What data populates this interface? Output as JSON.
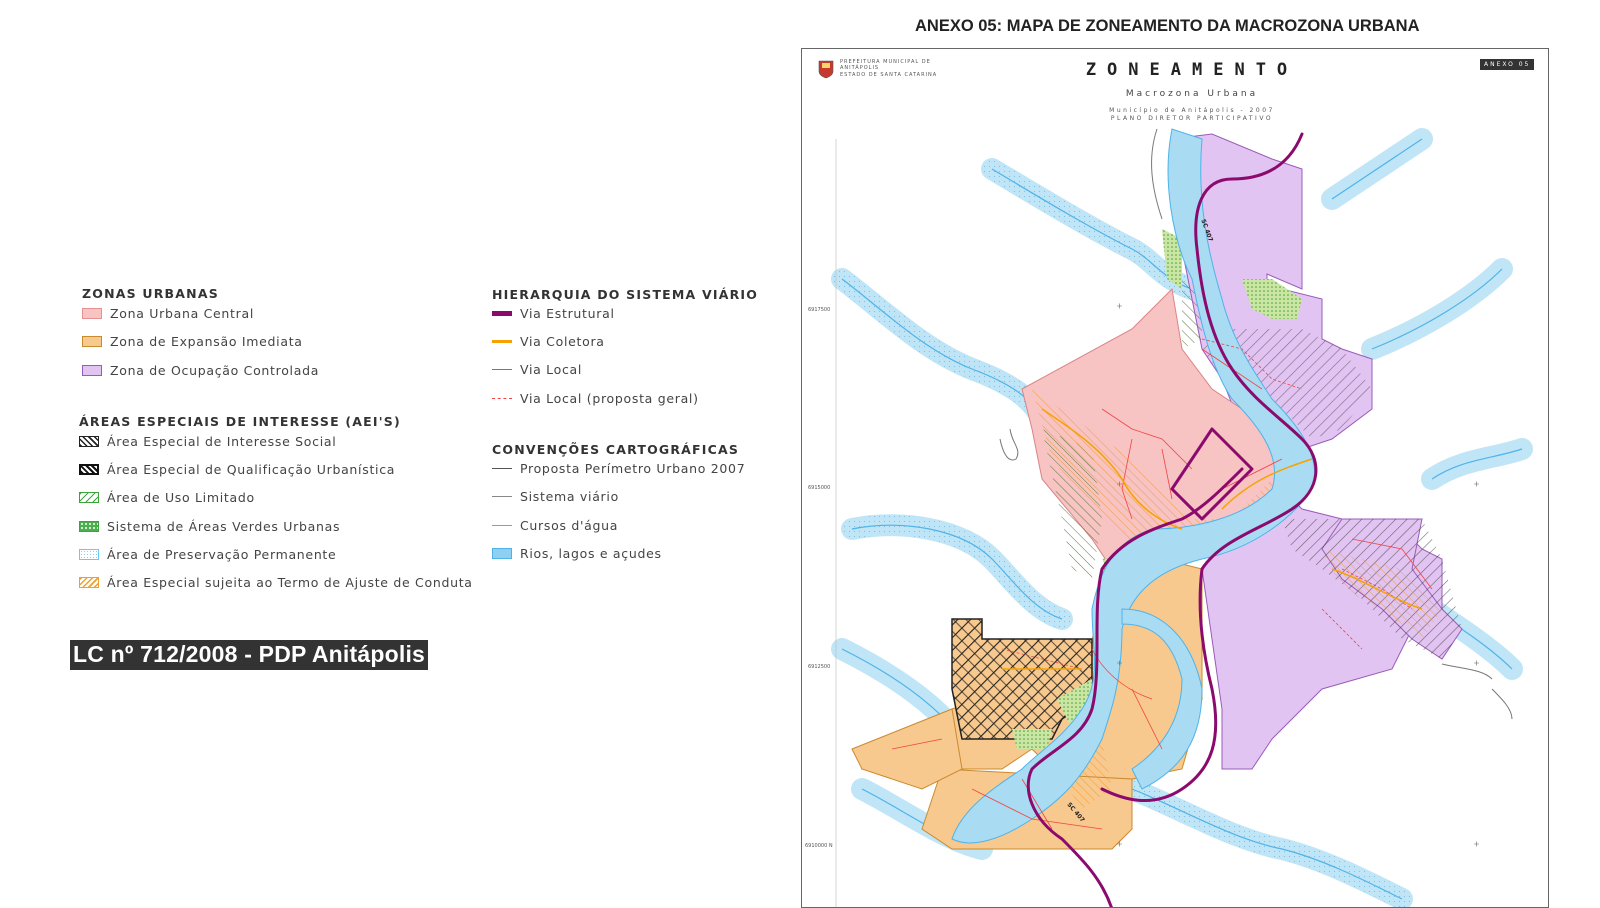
{
  "main_title": "ANEXO 05: MAPA DE ZONEAMENTO DA MACROZONA URBANA",
  "caption": "LC nº 712/2008 - PDP Anitápolis",
  "legend_left": {
    "zonas_title": "ZONAS URBANAS",
    "zonas": [
      {
        "label": "Zona Urbana Central",
        "color": "#f8c3c3"
      },
      {
        "label": "Zona de Expansão Imediata",
        "color": "#f8c98e"
      },
      {
        "label": "Zona de Ocupação Controlada",
        "color": "#e2c4f2"
      }
    ],
    "aei_title": "ÁREAS ESPECIAIS DE INTERESSE (AEI'S)",
    "aei": [
      {
        "label": "Área Especial de Interesse Social",
        "icon": "diagonal-hatch-black"
      },
      {
        "label": "Área Especial de Qualificação Urbanística",
        "icon": "cross-hatch-black"
      },
      {
        "label": "Área de Uso Limitado",
        "icon": "diagonal-hatch-green"
      },
      {
        "label": "Sistema de Áreas Verdes Urbanas",
        "icon": "dotted-green"
      },
      {
        "label": "Área de Preservação Permanente",
        "icon": "dotted-cyan"
      },
      {
        "label": "Área Especial sujeita ao Termo de Ajuste de Conduta",
        "icon": "hatch-orange"
      }
    ]
  },
  "legend_right": {
    "viario_title": "HIERARQUIA DO SISTEMA VIÁRIO",
    "viario": [
      {
        "label": "Via Estrutural",
        "color": "#8b0a6e"
      },
      {
        "label": "Via Coletora",
        "color": "#f5a200"
      },
      {
        "label": "Via Local",
        "color": "#f24444"
      },
      {
        "label": "Via Local (proposta geral)",
        "color": "#f24444"
      }
    ],
    "conv_title": "CONVENÇÕES CARTOGRÁFICAS",
    "conv": [
      {
        "label": "Proposta Perímetro Urbano 2007",
        "color": "#555555"
      },
      {
        "label": "Sistema viário",
        "color": "#888888"
      },
      {
        "label": "Cursos d'água",
        "color": "#4fb3e8"
      },
      {
        "label": "Rios, lagos e açudes",
        "color": "#8fd0f2"
      }
    ]
  },
  "map": {
    "title": "ZONEAMENTO",
    "subtitle": "Macrozona Urbana",
    "line1": "Município de Anitápolis - 2007",
    "line2": "PLANO DIRETOR PARTICIPATIVO",
    "org1": "PREFEITURA MUNICIPAL DE",
    "org2": "ANITÁPOLIS",
    "org3": "ESTADO DE SANTA CATARINA",
    "badge": "ANEXO 05",
    "road_label": "SC 407",
    "coords": [
      "6917500",
      "6915000",
      "6912500",
      "6910000 N"
    ]
  }
}
